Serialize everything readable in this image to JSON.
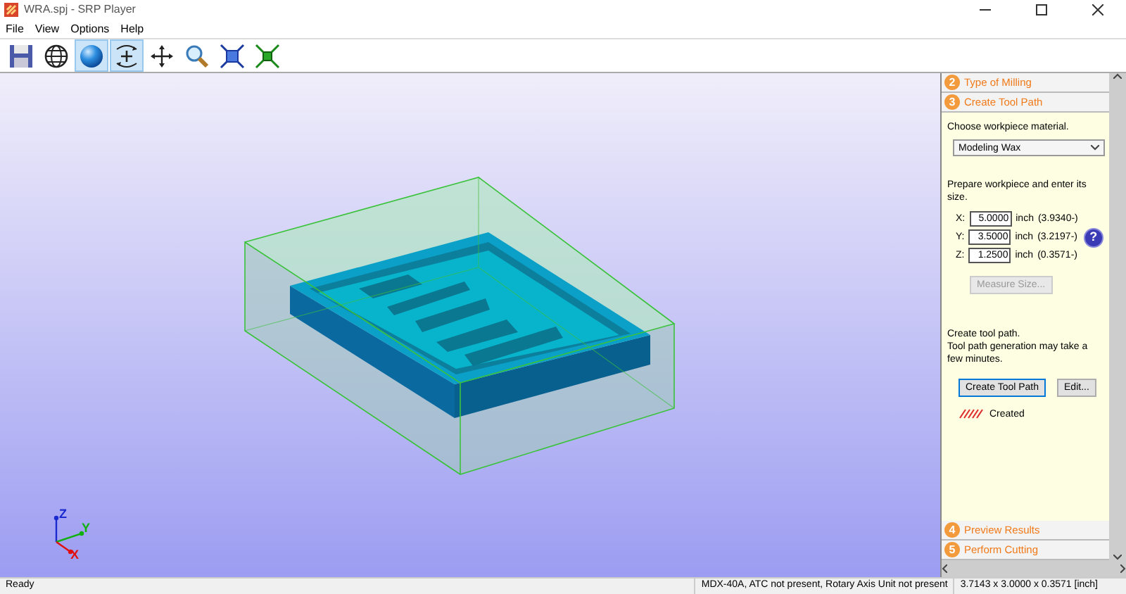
{
  "window": {
    "title": "WRA.spj - SRP Player"
  },
  "menu": [
    "File",
    "View",
    "Options",
    "Help"
  ],
  "toolbar": [
    {
      "kind": "save",
      "selected": false
    },
    {
      "kind": "wireframe",
      "selected": false
    },
    {
      "kind": "solid",
      "selected": true
    },
    {
      "kind": "rotate",
      "selected": true
    },
    {
      "kind": "pan",
      "selected": false
    },
    {
      "kind": "zoom",
      "selected": false
    },
    {
      "kind": "fit",
      "selected": false
    },
    {
      "kind": "shrink",
      "selected": false
    }
  ],
  "viewport": {
    "axes": [
      {
        "kind": "z",
        "label": "Z"
      },
      {
        "kind": "y",
        "label": "Y"
      },
      {
        "kind": "x",
        "label": "X"
      }
    ]
  },
  "steps": [
    {
      "number": "2",
      "label": "Type of Milling",
      "expanded": false
    },
    {
      "number": "3",
      "label": "Create Tool Path",
      "expanded": true
    },
    {
      "number": "4",
      "label": "Preview Results",
      "expanded": false
    },
    {
      "number": "5",
      "label": "Perform Cutting",
      "expanded": false
    }
  ],
  "tool_path_step": {
    "material_prompt": "Choose workpiece material.",
    "material": "Modeling Wax",
    "size_prompt": "Prepare workpiece and enter its size.",
    "sizes": [
      {
        "axis": "X:",
        "value": "5.0000",
        "unit": "inch",
        "measured": "(3.9340-)"
      },
      {
        "axis": "Y:",
        "value": "3.5000",
        "unit": "inch",
        "measured": "(3.2197-)"
      },
      {
        "axis": "Z:",
        "value": "1.2500",
        "unit": "inch",
        "measured": "(0.3571-)"
      }
    ],
    "help": "?",
    "measure_button": {
      "label": "Measure Size...",
      "disabled": true
    },
    "path_prompt": "Create tool path.",
    "path_note": "Tool path generation may take a few minutes.",
    "buttons": [
      {
        "label": "Create Tool Path",
        "selected": true
      },
      {
        "label": "Edit...",
        "selected": false
      }
    ],
    "status": "Created"
  },
  "status_bar": {
    "message": "Ready",
    "machine": "MDX-40A, ATC not present, Rotary Axis Unit not present",
    "size": "3.7143 x 3.0000 x 0.3571 [inch]"
  }
}
